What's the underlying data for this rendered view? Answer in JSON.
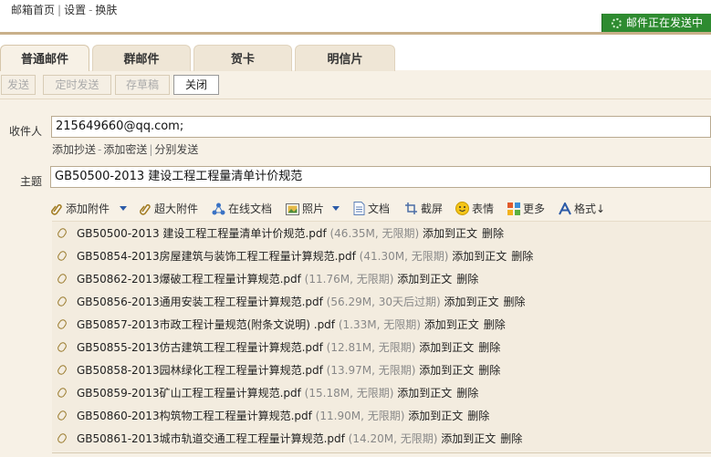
{
  "topnav": {
    "home": "邮箱首页",
    "settings": "设置",
    "skin": "换肤",
    "sep1": "|",
    "sep2": "-"
  },
  "status": {
    "text": "邮件正在发送中"
  },
  "tabs": [
    {
      "label": "普通邮件",
      "active": true
    },
    {
      "label": "群邮件",
      "active": false
    },
    {
      "label": "贺卡",
      "active": false
    },
    {
      "label": "明信片",
      "active": false
    }
  ],
  "toolbar": {
    "send": "发送",
    "scheduled": "定时发送",
    "draft": "存草稿",
    "close": "关闭"
  },
  "recipient": {
    "label": "收件人",
    "value": "215649660@qq.com;"
  },
  "recipient_links": {
    "cc": "添加抄送",
    "bcc": "添加密送",
    "separate": "分别发送",
    "sep1": "-",
    "sep2": "|"
  },
  "subject": {
    "label": "主题",
    "value": "GB50500-2013 建设工程工程量清单计价规范"
  },
  "attach_toolbar": {
    "add_attachment": "添加附件",
    "big_attachment": "超大附件",
    "online_doc": "在线文档",
    "photo": "照片",
    "document": "文档",
    "screenshot": "截屏",
    "emoji": "表情",
    "more": "更多",
    "format": "格式↓"
  },
  "attachments": [
    {
      "name": "GB50500-2013 建设工程工程量清单计价规范.pdf",
      "meta": "(46.35M, 无限期)"
    },
    {
      "name": "GB50854-2013房屋建筑与装饰工程工程量计算规范.pdf",
      "meta": "(41.30M, 无限期)"
    },
    {
      "name": "GB50862-2013爆破工程工程量计算规范.pdf",
      "meta": "(11.76M, 无限期)"
    },
    {
      "name": "GB50856-2013通用安装工程工程量计算规范.pdf",
      "meta": "(56.29M, 30天后过期)"
    },
    {
      "name": "GB50857-2013市政工程计量规范(附条文说明) .pdf",
      "meta": "(1.33M, 无限期)"
    },
    {
      "name": "GB50855-2013仿古建筑工程工程量计算规范.pdf",
      "meta": "(12.81M, 无限期)"
    },
    {
      "name": "GB50858-2013园林绿化工程工程量计算规范.pdf",
      "meta": "(13.97M, 无限期)"
    },
    {
      "name": "GB50859-2013矿山工程工程量计算规范.pdf",
      "meta": "(15.18M, 无限期)"
    },
    {
      "name": "GB50860-2013构筑物工程工程量计算规范.pdf",
      "meta": "(11.90M, 无限期)"
    },
    {
      "name": "GB50861-2013城市轨道交通工程工程量计算规范.pdf",
      "meta": "(14.20M, 无限期)"
    }
  ],
  "attachment_actions": {
    "insert": "添加到正文",
    "delete": "删除"
  },
  "colors": {
    "status_green": "#2e8b30",
    "panel": "#f7f1e6",
    "meta_gray": "#888888"
  }
}
